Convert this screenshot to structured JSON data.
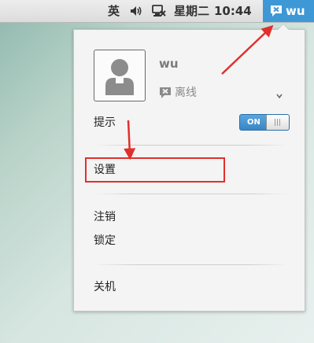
{
  "topbar": {
    "input_method": "英",
    "weekday": "星期二",
    "time": "10:44",
    "user_chip": {
      "name": "wu"
    },
    "icons": [
      "volume-icon",
      "network-offline-icon",
      "user-offline-icon"
    ]
  },
  "user_menu": {
    "user_name": "wu",
    "status": {
      "label": "离线",
      "icon": "offline-status-icon"
    },
    "notifications": {
      "label": "提示",
      "toggle": {
        "state_label": "ON",
        "value": true
      }
    },
    "settings_label": "设置",
    "logout_label": "注销",
    "lock_label": "锁定",
    "shutdown_label": "关机"
  },
  "colors": {
    "panel_accent": "#3f98d6",
    "annotation_red": "#e0302c",
    "toggle_on": "#4a96d2"
  }
}
